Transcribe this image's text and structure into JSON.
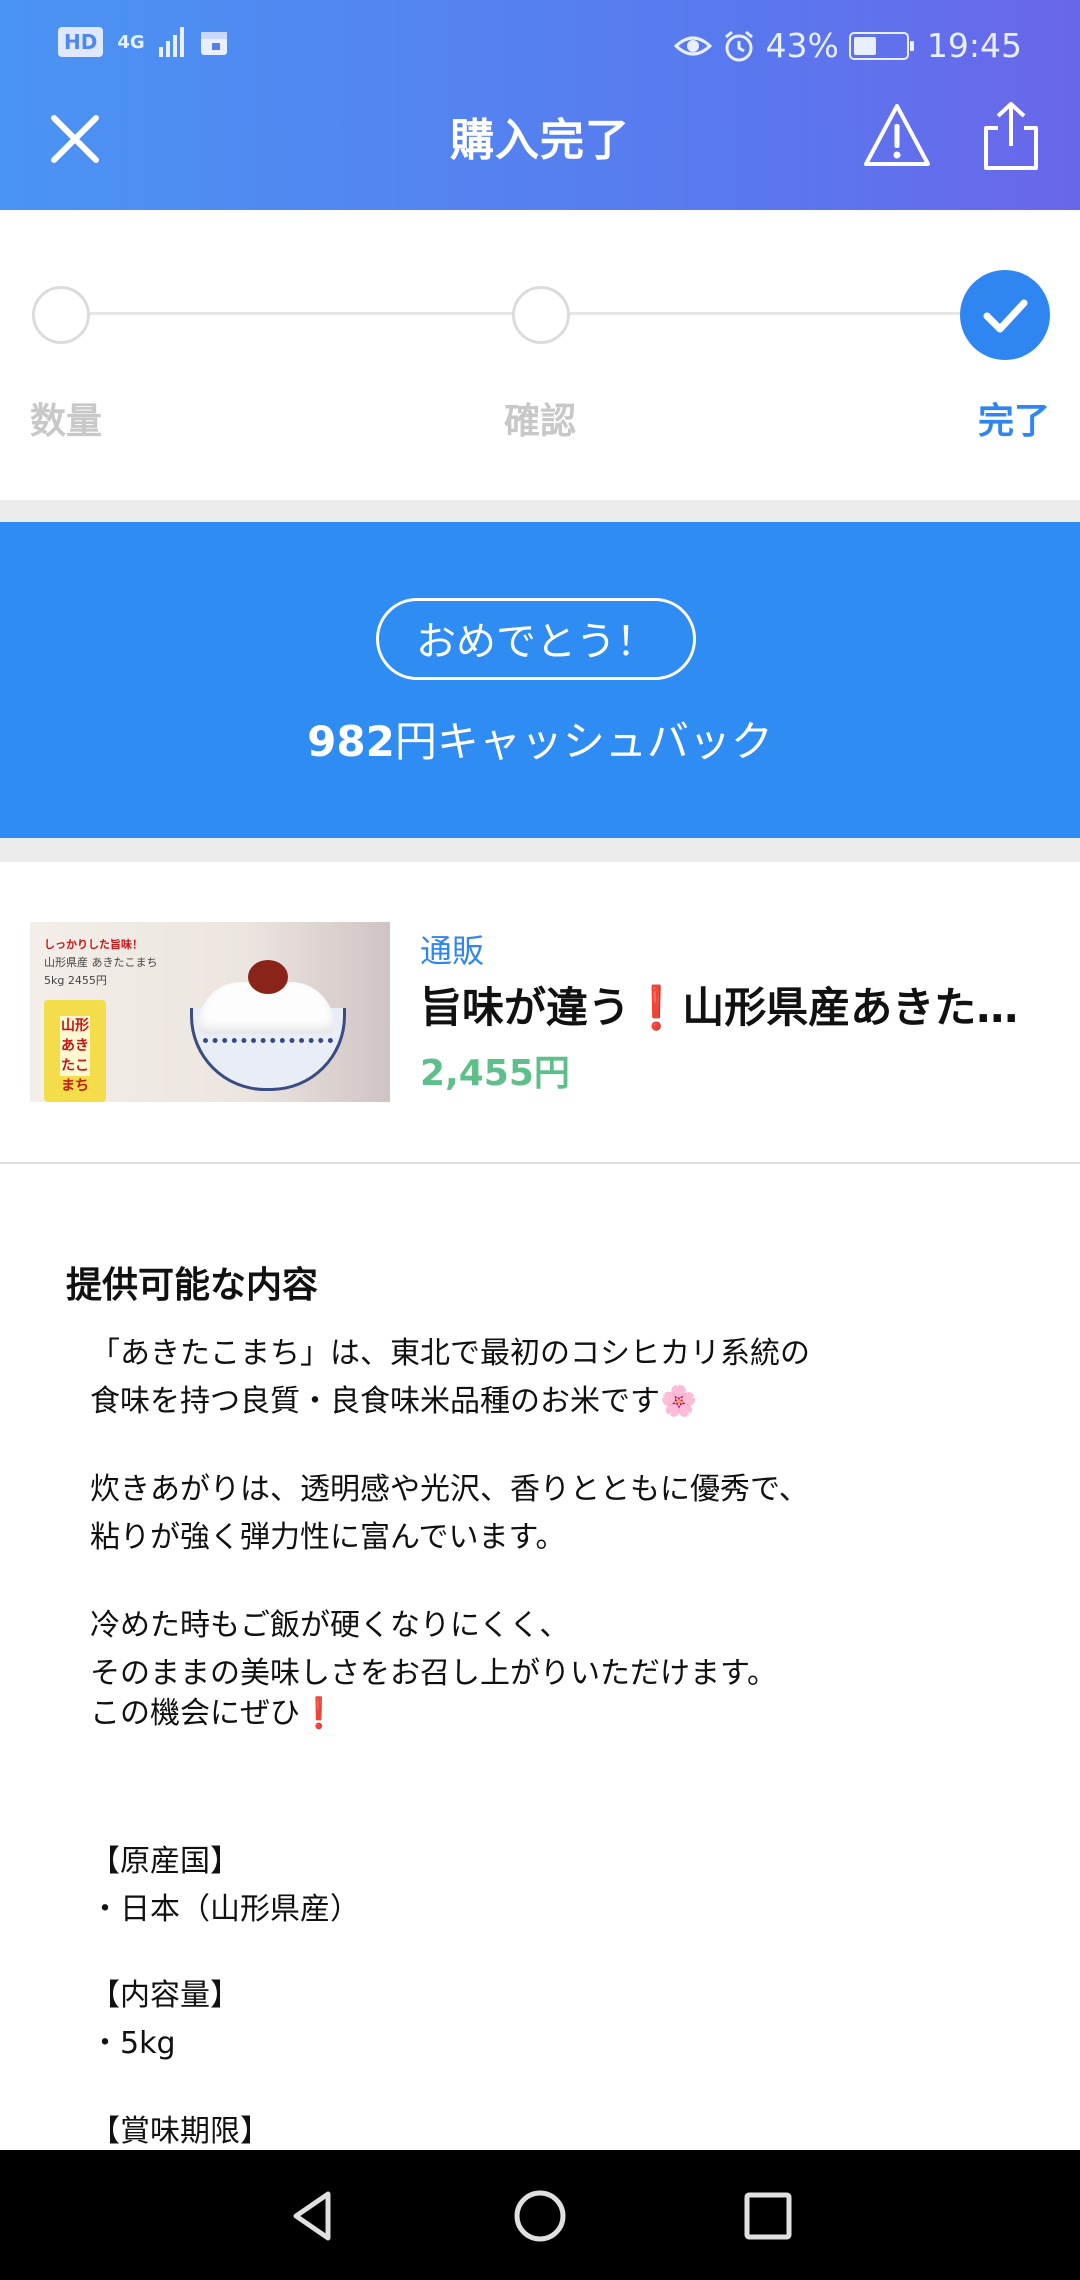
{
  "status_bar": {
    "hd": "HD",
    "network": "4G",
    "battery": "43%",
    "time": "19:45"
  },
  "header": {
    "title": "購入完了",
    "icons": [
      "close-icon",
      "warning-icon",
      "share-icon"
    ]
  },
  "stepper": {
    "steps": [
      {
        "label": "数量",
        "state": "inactive"
      },
      {
        "label": "確認",
        "state": "inactive"
      },
      {
        "label": "完了",
        "state": "complete"
      }
    ]
  },
  "banner": {
    "congrats": "おめでとう！",
    "cashback_amount": "982",
    "cashback_text": "円キャッシュバック"
  },
  "product": {
    "category": "通販",
    "name": "旨味が違う❗山形県産あきたこまち",
    "price": "2,455円",
    "thumb": {
      "tagline": "しっかりした旨味！",
      "line1": "山形県産 あきたこまち",
      "line2": "5kg 2455円",
      "bag_label": "山形 あきたこまち"
    }
  },
  "description": {
    "heading": "提供可能な内容",
    "p1": "「あきたこまち」は、東北で最初のコシヒカリ系統の\n食味を持つ良質・良食味米品種のお米です",
    "p1_emoji": "🌸",
    "p2": "炊きあがりは、透明感や光沢、香りとともに優秀で、\n粘りが強く弾力性に富んでいます。",
    "p3": "冷めた時もご飯が硬くなりにくく、\nそのままの美味しさをお召し上がりいただけます。",
    "p4": "この機会にぜひ",
    "p4_emoji": "❗",
    "p5": "【原産国】\n・日本（山形県産）",
    "p6": "【内容量】\n・5kg",
    "p7": "【賞味期限】"
  },
  "colors": {
    "accent": "#2f86f0",
    "banner": "#2f8cf2",
    "price_green": "#5fbf8a"
  }
}
